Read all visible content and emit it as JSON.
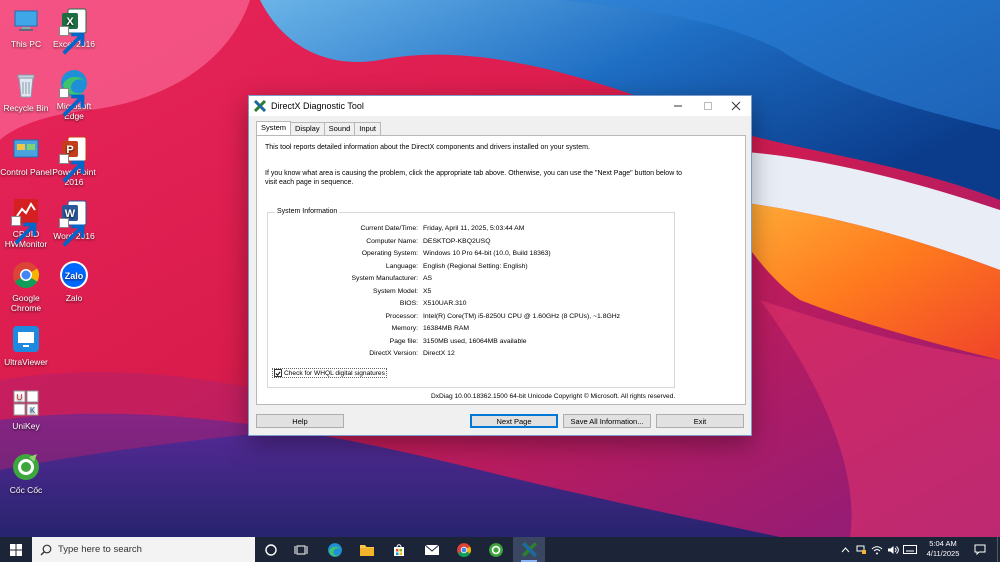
{
  "desktop": {
    "icons": [
      {
        "label": "This PC",
        "icon": "this-pc-icon"
      },
      {
        "label": "Excel 2016",
        "icon": "excel-icon"
      },
      {
        "label": "Recycle Bin",
        "icon": "recycle-bin-icon"
      },
      {
        "label": "Microsoft Edge",
        "icon": "edge-icon"
      },
      {
        "label": "Control Panel",
        "icon": "control-panel-icon"
      },
      {
        "label": "PowerPoint 2016",
        "icon": "powerpoint-icon"
      },
      {
        "label": "CPUID HWMonitor",
        "icon": "hwmonitor-icon"
      },
      {
        "label": "Word 2016",
        "icon": "word-icon"
      },
      {
        "label": "Google Chrome",
        "icon": "chrome-icon"
      },
      {
        "label": "Zalo",
        "icon": "zalo-icon"
      },
      {
        "label": "UltraViewer",
        "icon": "ultraviewer-icon"
      },
      {
        "label": "UniKey",
        "icon": "unikey-icon"
      },
      {
        "label": "Cốc Cốc",
        "icon": "coccoc-icon"
      }
    ]
  },
  "window": {
    "title": "DirectX Diagnostic Tool",
    "tabs": [
      "System",
      "Display",
      "Sound",
      "Input"
    ],
    "active_tab": "System",
    "intro1": "This tool reports detailed information about the DirectX components and drivers installed on your system.",
    "intro2": "If you know what area is causing the problem, click the appropriate tab above.  Otherwise, you can use the \"Next Page\" button below to visit each page in sequence.",
    "group_title": "System Information",
    "info": [
      {
        "key": "Current Date/Time:",
        "value": "Friday, April 11, 2025, 5:03:44 AM"
      },
      {
        "key": "Computer Name:",
        "value": "DESKTOP-KBQ2USQ"
      },
      {
        "key": "Operating System:",
        "value": "Windows 10 Pro 64-bit (10.0, Build 18363)"
      },
      {
        "key": "Language:",
        "value": "English (Regional Setting: English)"
      },
      {
        "key": "System Manufacturer:",
        "value": "AS"
      },
      {
        "key": "System Model:",
        "value": "X5"
      },
      {
        "key": "BIOS:",
        "value": "X510UAR.310"
      },
      {
        "key": "Processor:",
        "value": "Intel(R) Core(TM) i5-8250U CPU @ 1.60GHz (8 CPUs), ~1.8GHz"
      },
      {
        "key": "Memory:",
        "value": "16384MB RAM"
      },
      {
        "key": "Page file:",
        "value": "3150MB used, 16064MB available"
      },
      {
        "key": "DirectX Version:",
        "value": "DirectX 12"
      }
    ],
    "whql_label": "Check for WHQL digital signatures",
    "whql_checked": true,
    "copyright": "DxDiag 10.00.18362.1500 64-bit Unicode  Copyright © Microsoft. All rights reserved.",
    "buttons": {
      "help": "Help",
      "next_page": "Next Page",
      "save_all": "Save All Information...",
      "exit": "Exit"
    }
  },
  "taskbar": {
    "search_placeholder": "Type here to search",
    "time": "5:04 AM",
    "date": "4/11/2025"
  },
  "colors": {
    "accent": "#0078d7",
    "taskbar": "#1c2437",
    "window_border": "#7a9cc6"
  }
}
